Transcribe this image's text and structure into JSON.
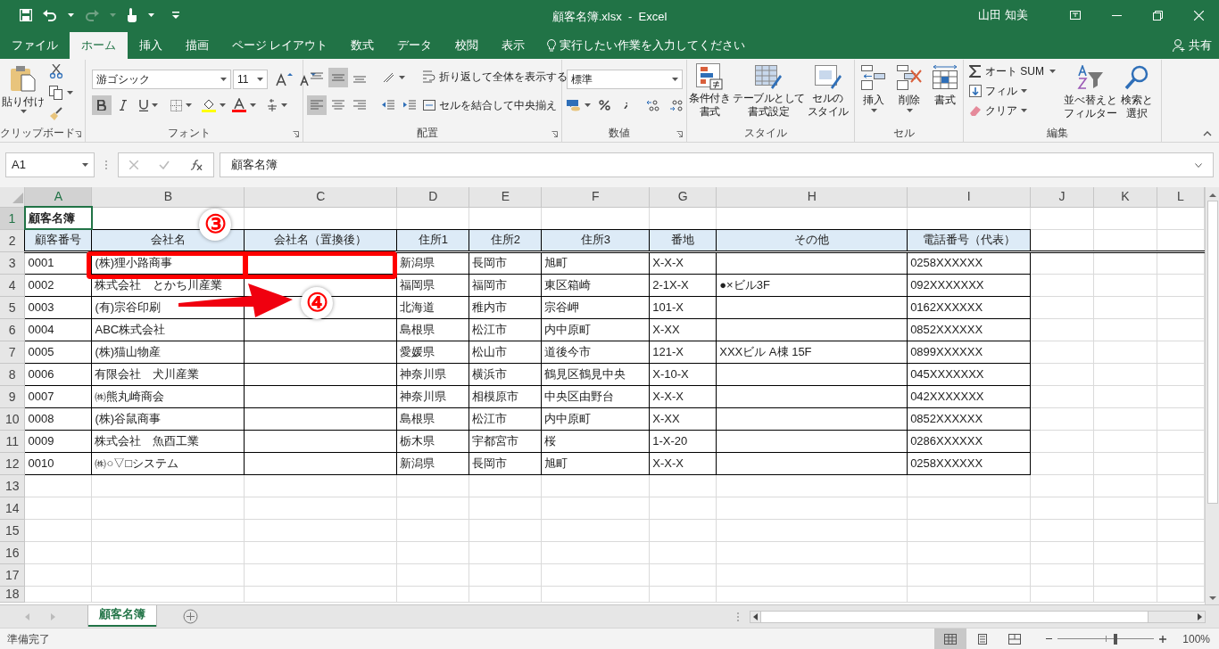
{
  "window": {
    "title": "顧客名簿.xlsx  -  Excel",
    "user": "山田 知美"
  },
  "tabs": [
    {
      "label": "ファイル",
      "selected": false
    },
    {
      "label": "ホーム",
      "selected": true
    },
    {
      "label": "挿入",
      "selected": false
    },
    {
      "label": "描画",
      "selected": false
    },
    {
      "label": "ページ レイアウト",
      "selected": false
    },
    {
      "label": "数式",
      "selected": false
    },
    {
      "label": "データ",
      "selected": false
    },
    {
      "label": "校閲",
      "selected": false
    },
    {
      "label": "表示",
      "selected": false
    }
  ],
  "tell_me": "実行したい作業を入力してください",
  "share": "共有",
  "ribbon": {
    "clipboard": {
      "paste": "貼り付け",
      "label": "クリップボード"
    },
    "font": {
      "name": "游ゴシック",
      "size": "11",
      "bold": true,
      "label": "フォント"
    },
    "alignment": {
      "vertical_buttons": [
        {
          "kind": "top",
          "selected": false
        },
        {
          "kind": "middle",
          "selected": true
        },
        {
          "kind": "bottom",
          "selected": false
        }
      ],
      "horizontal_buttons": [
        {
          "kind": "left",
          "selected": true
        },
        {
          "kind": "center",
          "selected": false
        },
        {
          "kind": "right",
          "selected": false
        }
      ],
      "wrap": "折り返して全体を表示する",
      "merge": "セルを結合して中央揃え",
      "label": "配置"
    },
    "number": {
      "format": "標準",
      "label": "数値"
    },
    "styles": {
      "buttons": [
        [
          "条件付き",
          "書式"
        ],
        [
          "テーブルとして",
          "書式設定"
        ],
        [
          "セルの",
          "スタイル"
        ]
      ],
      "label": "スタイル"
    },
    "cells": {
      "buttons": [
        "挿入",
        "削除",
        "書式"
      ],
      "label": "セル"
    },
    "editing": {
      "autosum": "オート SUM",
      "fill": "フィル",
      "clear": "クリア",
      "buttons": [
        [
          "並べ替えと",
          "フィルター"
        ],
        [
          "検索と",
          "選択"
        ]
      ],
      "label": "編集"
    }
  },
  "formula_bar": {
    "name_box": "A1",
    "value": "顧客名簿"
  },
  "sheet": {
    "columns": [
      {
        "label": "A",
        "selected": true
      },
      {
        "label": "B",
        "selected": false
      },
      {
        "label": "C",
        "selected": false
      },
      {
        "label": "D",
        "selected": false
      },
      {
        "label": "E",
        "selected": false
      },
      {
        "label": "F",
        "selected": false
      },
      {
        "label": "G",
        "selected": false
      },
      {
        "label": "H",
        "selected": false
      },
      {
        "label": "I",
        "selected": false
      },
      {
        "label": "J",
        "selected": false
      },
      {
        "label": "K",
        "selected": false
      },
      {
        "label": "L",
        "selected": false
      }
    ],
    "rows": [
      {
        "number": "1",
        "kind": "title",
        "selected": true,
        "cells": [
          "顧客名簿"
        ]
      },
      {
        "number": "2",
        "kind": "header",
        "selected": false,
        "cells": [
          "顧客番号",
          "会社名",
          "会社名（置換後）",
          "住所1",
          "住所2",
          "住所3",
          "番地",
          "その他",
          "電話番号（代表）"
        ]
      },
      {
        "number": "3",
        "kind": "data",
        "selected": false,
        "cells": [
          "0001",
          "(株)狸小路商事",
          null,
          "新潟県",
          "長岡市",
          "旭町",
          "X-X-X",
          null,
          "0258XXXXXX"
        ]
      },
      {
        "number": "4",
        "kind": "data",
        "selected": false,
        "cells": [
          "0002",
          "株式会社　とかち川産業",
          null,
          "福岡県",
          "福岡市",
          "東区箱崎",
          "2-1X-X",
          "●×ビル3F",
          "092XXXXXXX"
        ]
      },
      {
        "number": "5",
        "kind": "data",
        "selected": false,
        "cells": [
          "0003",
          "(有)宗谷印刷",
          null,
          "北海道",
          "稚内市",
          "宗谷岬",
          "101-X",
          null,
          "0162XXXXXX"
        ]
      },
      {
        "number": "6",
        "kind": "data",
        "selected": false,
        "cells": [
          "0004",
          "ABC株式会社",
          null,
          "島根県",
          "松江市",
          "内中原町",
          "X-XX",
          null,
          "0852XXXXXX"
        ]
      },
      {
        "number": "7",
        "kind": "data",
        "selected": false,
        "cells": [
          "0005",
          "(株)猫山物産",
          null,
          "愛媛県",
          "松山市",
          "道後今市",
          "121-X",
          "XXXビル A棟 15F",
          "0899XXXXXX"
        ]
      },
      {
        "number": "8",
        "kind": "data",
        "selected": false,
        "cells": [
          "0006",
          "有限会社　犬川産業",
          null,
          "神奈川県",
          "横浜市",
          "鶴見区鶴見中央",
          "X-10-X",
          null,
          "045XXXXXXX"
        ]
      },
      {
        "number": "9",
        "kind": "data",
        "selected": false,
        "cells": [
          "0007",
          "㈱熊丸崎商会",
          null,
          "神奈川県",
          "相模原市",
          "中央区由野台",
          "X-X-X",
          null,
          "042XXXXXXX"
        ]
      },
      {
        "number": "10",
        "kind": "data",
        "selected": false,
        "cells": [
          "0008",
          "(株)谷鼠商事",
          null,
          "島根県",
          "松江市",
          "内中原町",
          "X-XX",
          null,
          "0852XXXXXX"
        ]
      },
      {
        "number": "11",
        "kind": "data",
        "selected": false,
        "cells": [
          "0009",
          "株式会社　魚酉工業",
          null,
          "栃木県",
          "宇都宮市",
          "桜",
          "1-X-20",
          null,
          "0286XXXXXX"
        ]
      },
      {
        "number": "12",
        "kind": "data",
        "selected": false,
        "cells": [
          "0010",
          "㈱○▽□システム",
          null,
          "新潟県",
          "長岡市",
          "旭町",
          "X-X-X",
          null,
          "0258XXXXXX"
        ]
      },
      {
        "number": "13",
        "kind": "empty",
        "selected": false
      },
      {
        "number": "14",
        "kind": "empty",
        "selected": false
      },
      {
        "number": "15",
        "kind": "empty",
        "selected": false
      },
      {
        "number": "16",
        "kind": "empty",
        "selected": false
      },
      {
        "number": "17",
        "kind": "empty",
        "selected": false
      },
      {
        "number": "18",
        "kind": "empty",
        "selected": false
      }
    ]
  },
  "callouts": [
    {
      "label": "③"
    },
    {
      "label": "④"
    }
  ],
  "sheet_tabs": [
    {
      "label": "顧客名簿",
      "selected": true
    }
  ],
  "status_bar": {
    "text": "準備完了",
    "views": [
      {
        "kind": "normal",
        "selected": true
      },
      {
        "kind": "page_layout",
        "selected": false
      },
      {
        "kind": "page_break",
        "selected": false
      }
    ],
    "zoom": {
      "level": 0.6,
      "label": "100%"
    }
  }
}
